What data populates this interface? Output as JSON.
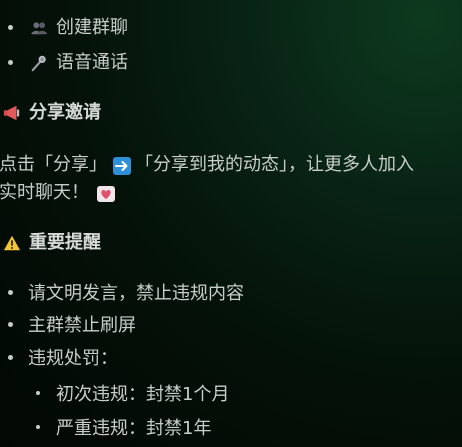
{
  "list_top": [
    {
      "icon": "people-icon",
      "label": "创建群聊"
    },
    {
      "icon": "microphone-icon",
      "label": "语音通话"
    }
  ],
  "share_section": {
    "icon": "megaphone-icon",
    "title": "分享邀请",
    "line1_prefix": "点击「分享」",
    "line1_arrow_icon": "right-arrow-icon",
    "line1_suffix": "「分享到我的动态」，让更多人加入",
    "line2": "实时聊天！",
    "line2_icon": "heart-icon"
  },
  "notice_section": {
    "icon": "warning-icon",
    "title": "重要提醒",
    "items": [
      "请文明发言，禁止违规内容",
      "主群禁止刷屏",
      "违规处罚："
    ],
    "sub_items": [
      "初次违规：封禁1个月",
      "严重违规：封禁1年"
    ]
  }
}
